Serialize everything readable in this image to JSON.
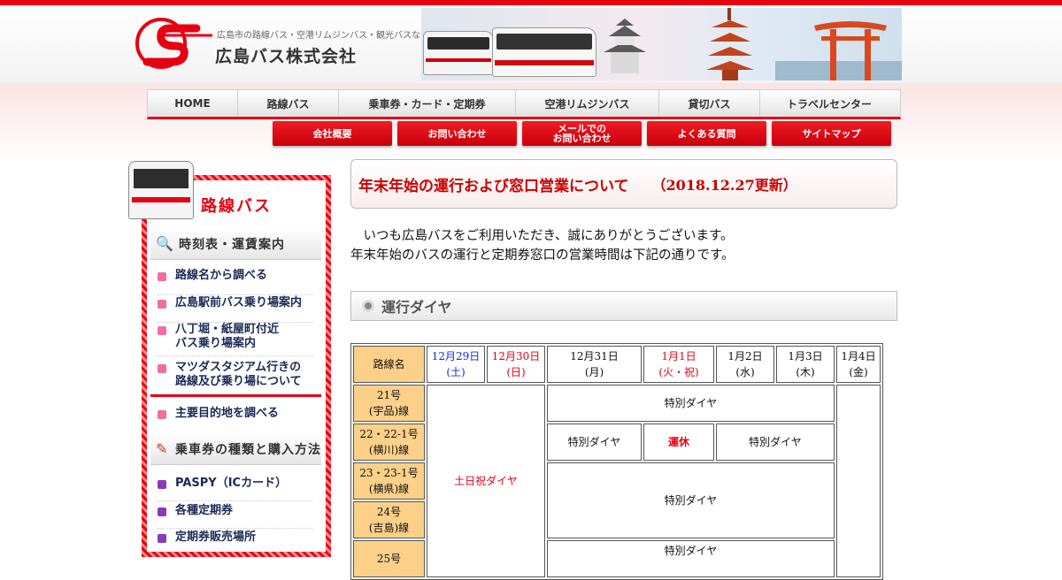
{
  "header": {
    "tagline": "広島市の路線バス・空港リムジンバス・観光バスなら",
    "company": "広島バス株式会社"
  },
  "mainnav": [
    "HOME",
    "路線バス",
    "乗車券・カード・定期券",
    "空港リムジンバス",
    "貸切バス",
    "トラベルセンター"
  ],
  "subnav": [
    "会社概要",
    "お問い合わせ",
    "メールでの\nお問い合わせ",
    "よくある質問",
    "サイトマップ"
  ],
  "sidebar": {
    "title": "路線バス",
    "section1": "時刻表・運賃案内",
    "links1": [
      "路線名から調べる",
      "広島駅前バス乗り場案内",
      "八丁堀・紙屋町付近\nバス乗り場案内",
      "マツダスタジアム行きの\n路線及び乗り場について"
    ],
    "link2": "主要目的地を調べる",
    "section2": "乗車券の種類と購入方法",
    "links2": [
      "PASPY（ICカード）",
      "各種定期券",
      "定期券販売場所"
    ]
  },
  "notice": {
    "title": "年末年始の運行および窓口営業について",
    "date": "（2018.12.27更新）"
  },
  "intro": {
    "line1": "　いつも広島バスをご利用いただき、誠にありがとうございます。",
    "line2": "年末年始のバスの運行と定期券窓口の営業時間は下記の通りです。"
  },
  "section": {
    "title": "運行ダイヤ"
  },
  "schedule": {
    "route_header": "路線名",
    "days": [
      {
        "date": "12月29日",
        "dow": "(土)",
        "color": "#1a28e6"
      },
      {
        "date": "12月30日",
        "dow": "(日)",
        "color": "#e60012"
      },
      {
        "date": "12月31日",
        "dow": "(月)",
        "color": "#111111"
      },
      {
        "date": "1月1日",
        "dow": "(火・祝)",
        "color": "#e60012"
      },
      {
        "date": "1月2日",
        "dow": "(水)",
        "color": "#111111"
      },
      {
        "date": "1月3日",
        "dow": "(木)",
        "color": "#111111"
      },
      {
        "date": "1月4日",
        "dow": "(金)",
        "color": "#111111"
      }
    ],
    "routes": [
      {
        "no": "21号",
        "name": "(宇品)線"
      },
      {
        "no": "22・22-1号",
        "name": "(横川)線"
      },
      {
        "no": "23・23-1号",
        "name": "(横県)線"
      },
      {
        "no": "24号",
        "name": "(吉島)線"
      },
      {
        "no": "25号",
        "name": ""
      }
    ],
    "weekend_label": "土日祝ダイヤ",
    "special_label": "特別ダイヤ",
    "suspended_label": "運休"
  }
}
